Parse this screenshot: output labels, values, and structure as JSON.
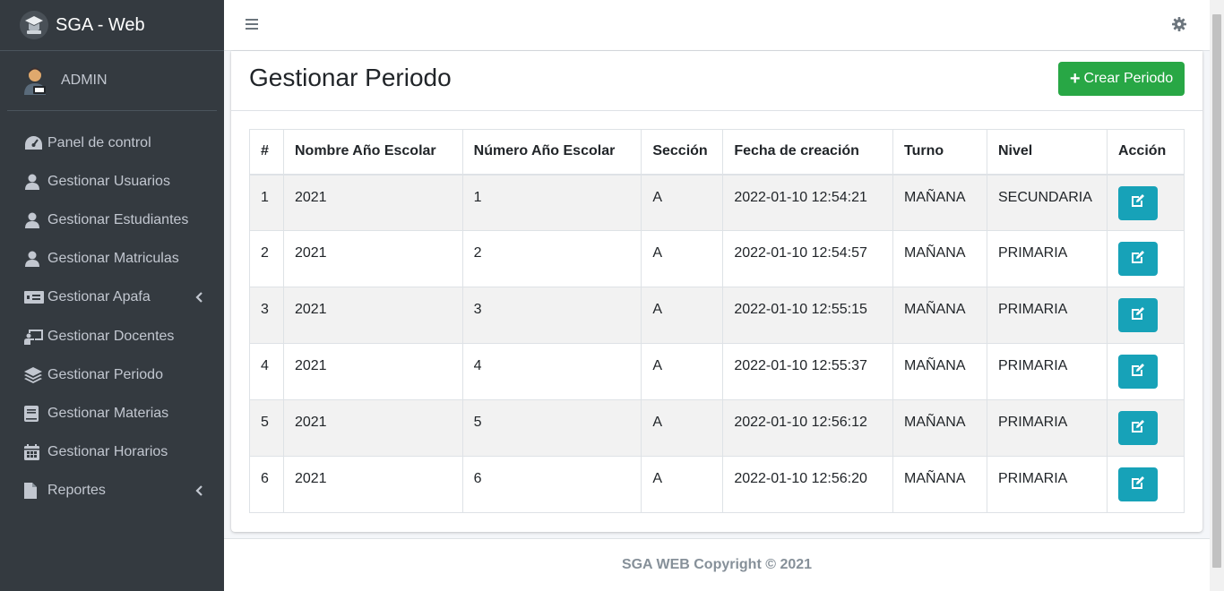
{
  "brand": {
    "name": "SGA - Web"
  },
  "user": {
    "name": "ADMIN"
  },
  "sidebar": {
    "items": [
      {
        "label": "Panel de control",
        "icon": "tachometer-icon"
      },
      {
        "label": "Gestionar Usuarios",
        "icon": "user-icon"
      },
      {
        "label": "Gestionar Estudiantes",
        "icon": "user-icon"
      },
      {
        "label": "Gestionar Matriculas",
        "icon": "user-icon"
      },
      {
        "label": "Gestionar Apafa",
        "icon": "money-bill-icon"
      },
      {
        "label": "Gestionar Docentes",
        "icon": "chalkboard-teacher-icon"
      },
      {
        "label": "Gestionar Periodo",
        "icon": "layer-group-icon"
      },
      {
        "label": "Gestionar Materias",
        "icon": "book-icon"
      },
      {
        "label": "Gestionar Horarios",
        "icon": "calendar-icon"
      },
      {
        "label": "Reportes",
        "icon": "file-icon"
      }
    ]
  },
  "page": {
    "title": "Gestionar Periodo",
    "create_label": "Crear Periodo"
  },
  "table": {
    "headers": [
      "#",
      "Nombre Año Escolar",
      "Número Año Escolar",
      "Sección",
      "Fecha de creación",
      "Turno",
      "Nivel",
      "Acción"
    ],
    "rows": [
      [
        "1",
        "2021",
        "1",
        "A",
        "2022-01-10 12:54:21",
        "MAÑANA",
        "SECUNDARIA"
      ],
      [
        "2",
        "2021",
        "2",
        "A",
        "2022-01-10 12:54:57",
        "MAÑANA",
        "PRIMARIA"
      ],
      [
        "3",
        "2021",
        "3",
        "A",
        "2022-01-10 12:55:15",
        "MAÑANA",
        "PRIMARIA"
      ],
      [
        "4",
        "2021",
        "4",
        "A",
        "2022-01-10 12:55:37",
        "MAÑANA",
        "PRIMARIA"
      ],
      [
        "5",
        "2021",
        "5",
        "A",
        "2022-01-10 12:56:12",
        "MAÑANA",
        "PRIMARIA"
      ],
      [
        "6",
        "2021",
        "6",
        "A",
        "2022-01-10 12:56:20",
        "MAÑANA",
        "PRIMARIA"
      ]
    ]
  },
  "footer": {
    "text": "SGA WEB Copyright © 2021"
  },
  "colors": {
    "sidebar_bg": "#343a40",
    "success": "#28a745",
    "info": "#17a2b8"
  }
}
